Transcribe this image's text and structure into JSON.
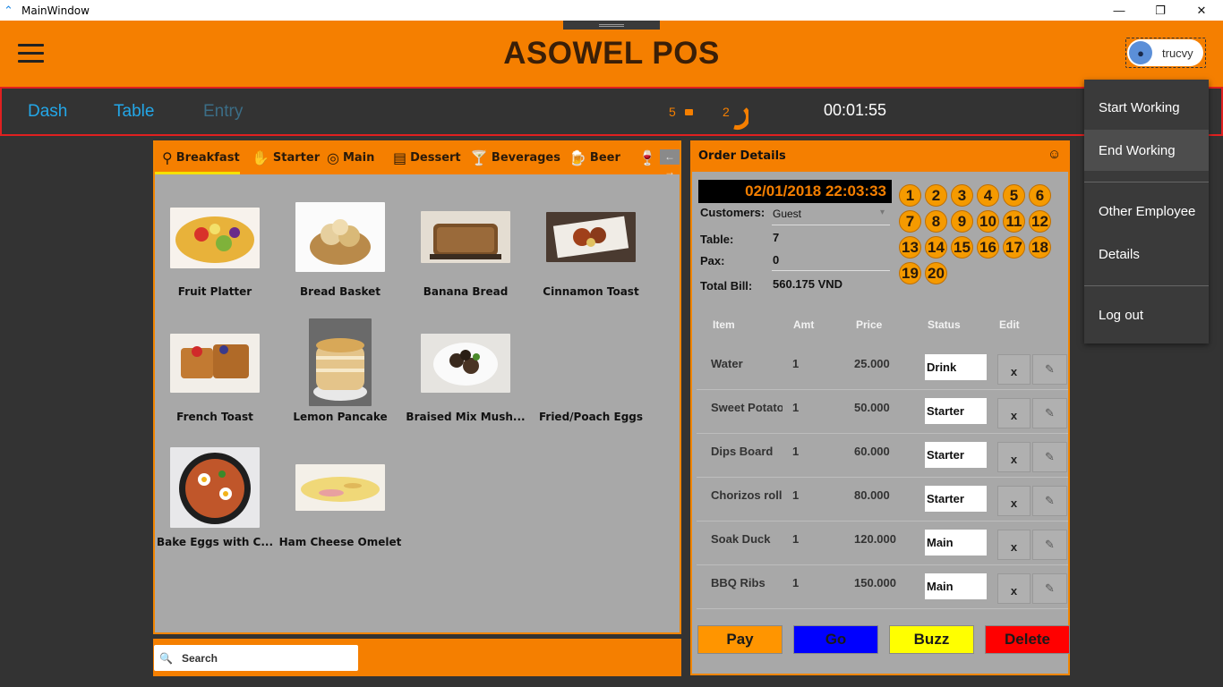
{
  "window": {
    "title": "MainWindow",
    "min": "—",
    "max": "❐",
    "close": "✕"
  },
  "header": {
    "title": "ASOWEL POS",
    "user": "trucvy"
  },
  "nav": {
    "dash": "Dash",
    "table": "Table",
    "entry": "Entry",
    "count_a": "5",
    "count_b": "2",
    "clock": "00:01:55"
  },
  "categories": [
    {
      "label": "Breakfast",
      "icon": "breakfast-icon",
      "glyph": "⚲",
      "selected": true
    },
    {
      "label": "Starter",
      "icon": "hand-icon",
      "glyph": "✋"
    },
    {
      "label": "Main",
      "icon": "plate-icon",
      "glyph": "◎"
    },
    {
      "label": "Dessert",
      "icon": "cake-icon",
      "glyph": "▤"
    },
    {
      "label": "Beverages",
      "icon": "cocktail-icon",
      "glyph": "🍸"
    },
    {
      "label": "Beer",
      "icon": "beer-icon",
      "glyph": "🍺"
    }
  ],
  "cat_scroll": "← →",
  "foods": [
    {
      "name": "Fruit Platter"
    },
    {
      "name": "Bread Basket"
    },
    {
      "name": "Banana Bread"
    },
    {
      "name": "Cinnamon Toast"
    },
    {
      "name": "French Toast"
    },
    {
      "name": "Lemon Pancake"
    },
    {
      "name": "Braised Mix Mush..."
    },
    {
      "name": "Fried/Poach Eggs"
    },
    {
      "name": "Bake Eggs with C..."
    },
    {
      "name": "Ham Cheese Omelet"
    }
  ],
  "search": {
    "placeholder": "Search"
  },
  "order": {
    "title": "Order Details",
    "datetime": "02/01/2018 22:03:33",
    "customers_label": "Customers:",
    "customers_value": "Guest",
    "table_label": "Table:",
    "table_value": "7",
    "pax_label": "Pax:",
    "pax_value": "0",
    "total_label": "Total Bill:",
    "total_value": "560.175 VND",
    "tables": [
      "1",
      "2",
      "3",
      "4",
      "5",
      "6",
      "7",
      "8",
      "9",
      "10",
      "11",
      "12",
      "13",
      "14",
      "15",
      "16",
      "17",
      "18",
      "19",
      "20"
    ],
    "headers": {
      "item": "Item",
      "amt": "Amt",
      "price": "Price",
      "status": "Status",
      "edit": "Edit"
    },
    "rows": [
      {
        "item": "Water",
        "amt": "1",
        "price": "25.000",
        "status": "Drink",
        "x": "x"
      },
      {
        "item": "Sweet Potato",
        "amt": "1",
        "price": "50.000",
        "status": "Starter",
        "x": "x"
      },
      {
        "item": "Dips Board",
        "amt": "1",
        "price": "60.000",
        "status": "Starter",
        "x": "x"
      },
      {
        "item": "Chorizos roll",
        "amt": "1",
        "price": "80.000",
        "status": "Starter",
        "x": "x"
      },
      {
        "item": "Soak Duck",
        "amt": "1",
        "price": "120.000",
        "status": "Main",
        "x": "x"
      },
      {
        "item": "BBQ Ribs",
        "amt": "1",
        "price": "150.000",
        "status": "Main",
        "x": "x"
      }
    ],
    "actions": {
      "pay": "Pay",
      "go": "Go",
      "buzz": "Buzz",
      "delete": "Delete"
    }
  },
  "user_menu": {
    "start": "Start Working",
    "end": "End Working",
    "other": "Other Employee",
    "details": "Details",
    "logout": "Log out"
  },
  "colors": {
    "accent": "#f57f00",
    "nav_link": "#23a7e8",
    "pay": "#ff9500",
    "go": "#0000ff",
    "buzz": "#ffff00",
    "delete": "#ff0000"
  }
}
